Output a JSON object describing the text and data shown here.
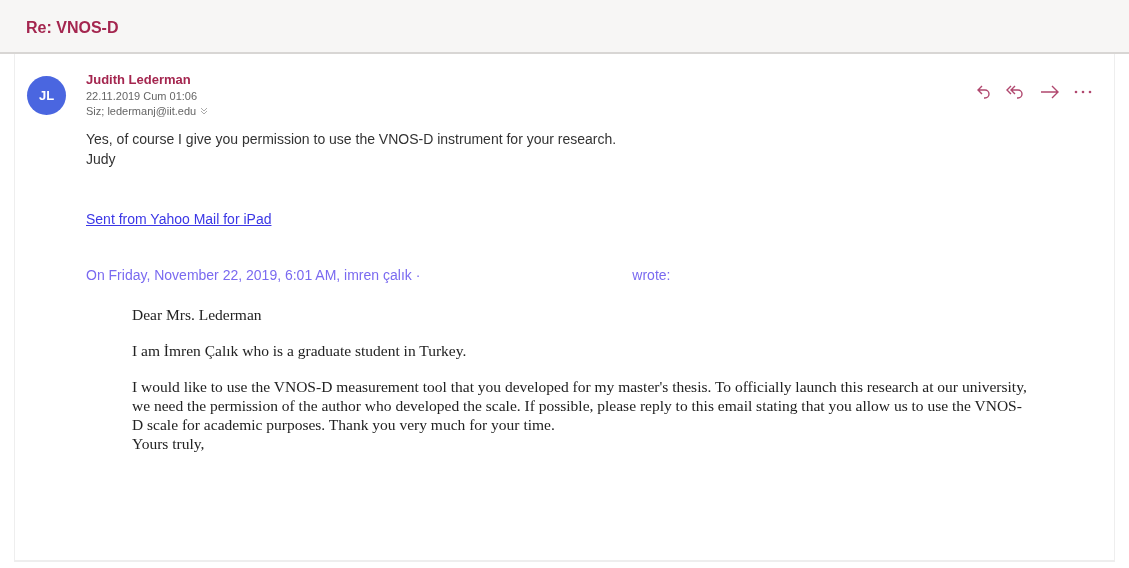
{
  "subject": "Re: VNOS-D",
  "message": {
    "avatar": "JL",
    "sender": "Judith Lederman",
    "date": "22.11.2019 Cum 01:06",
    "to": "Siz; ledermanj@iit.edu",
    "body": [
      "Yes, of course I give you permission to use the VNOS-D instrument for your research.",
      "Judy"
    ],
    "signature_link": "Sent from Yahoo Mail for iPad",
    "quote_header": "On Friday, November 22, 2019, 6:01 AM, imren çalık ·",
    "quote_header_end": "wrote:",
    "quote": [
      "Dear Mrs. Lederman",
      "I am İmren Çalık who is a graduate student in Turkey.",
      "I would like to use the VNOS-D measurement tool that you developed for my master's thesis. To officially launch this research at our university, we need the permission of the author who developed the scale. If possible, please reply to this email stating that you allow us to use the VNOS-D scale for academic purposes. Thank you very much for your time.\nYours truly,"
    ]
  }
}
